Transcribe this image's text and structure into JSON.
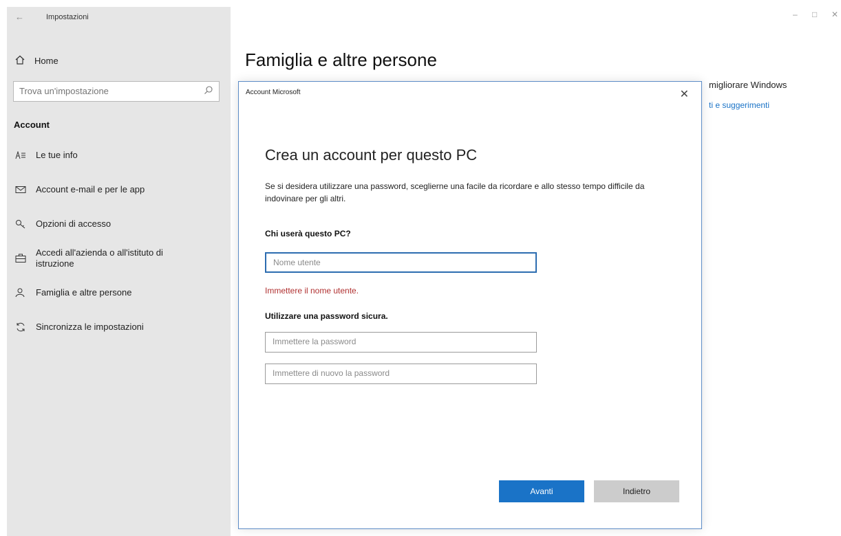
{
  "app": {
    "title": "Impostazioni"
  },
  "sidebar": {
    "home_label": "Home",
    "search_placeholder": "Trova un'impostazione",
    "section_label": "Account",
    "items": [
      {
        "label": "Le tue info",
        "icon": "person-info-icon"
      },
      {
        "label": "Account e-mail e per le app",
        "icon": "mail-icon"
      },
      {
        "label": "Opzioni di accesso",
        "icon": "key-icon"
      },
      {
        "label": "Accedi all'azienda o all'istituto di istruzione",
        "icon": "briefcase-icon"
      },
      {
        "label": "Famiglia e altre persone",
        "icon": "people-icon"
      },
      {
        "label": "Sincronizza le impostazioni",
        "icon": "sync-icon"
      }
    ]
  },
  "main": {
    "page_title": "Famiglia e altre persone",
    "right_text": "migliorare Windows",
    "right_link": "ti e suggerimenti"
  },
  "dialog": {
    "title": "Account Microsoft",
    "heading": "Crea un account per questo PC",
    "description": "Se si desidera utilizzare una password, sceglierne una facile da ricordare e allo stesso tempo difficile da indovinare per gli altri.",
    "question": "Chi userà questo PC?",
    "username_placeholder": "Nome utente",
    "error": "Immettere il nome utente.",
    "password_heading": "Utilizzare una password sicura.",
    "password_placeholder": "Immettere la password",
    "password_confirm_placeholder": "Immettere di nuovo la password",
    "next_label": "Avanti",
    "back_label": "Indietro"
  },
  "colors": {
    "accent": "#1a73c7",
    "error": "#b03030",
    "sidebar_bg": "#e6e6e6"
  }
}
